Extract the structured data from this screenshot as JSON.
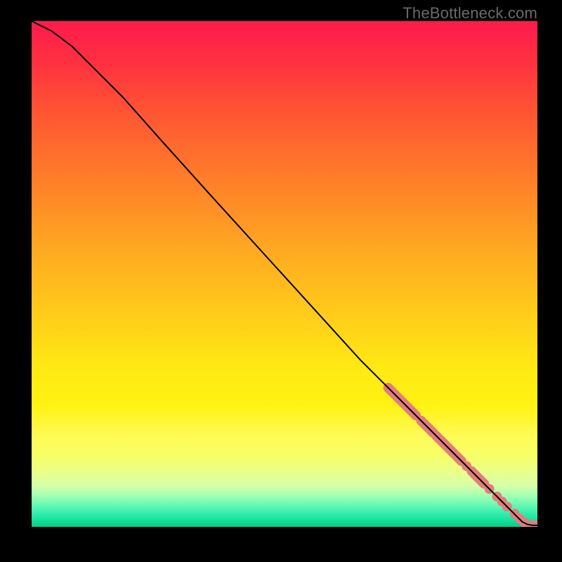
{
  "watermark": "TheBottleneck.com",
  "chart_data": {
    "type": "line",
    "title": "",
    "xlabel": "",
    "ylabel": "",
    "xlim": [
      0,
      100
    ],
    "ylim": [
      0,
      100
    ],
    "grid": false,
    "legend": false,
    "series": [
      {
        "name": "curve",
        "x": [
          0,
          4,
          8,
          12,
          18,
          26,
          35,
          45,
          55,
          65,
          72,
          78,
          83,
          87,
          90,
          93,
          95,
          97,
          98,
          99,
          100
        ],
        "y": [
          100,
          98,
          95,
          91,
          85,
          76,
          66,
          55,
          44,
          33,
          26,
          20,
          15,
          11,
          8,
          5,
          3,
          1,
          0.5,
          0.3,
          0.3
        ]
      }
    ],
    "highlight_clusters": [
      {
        "type": "segment",
        "x0": 70.5,
        "y0": 27.5,
        "x1": 76.0,
        "y1": 22.0
      },
      {
        "type": "segment",
        "x0": 77.0,
        "y0": 21.0,
        "x1": 79.5,
        "y1": 18.5
      },
      {
        "type": "segment",
        "x0": 80.0,
        "y0": 18.0,
        "x1": 85.0,
        "y1": 13.0
      },
      {
        "type": "dot",
        "x": 86.0,
        "y": 12.0
      },
      {
        "type": "dot",
        "x": 87.0,
        "y": 11.0
      },
      {
        "type": "segment",
        "x0": 87.5,
        "y0": 10.5,
        "x1": 89.5,
        "y1": 8.5
      },
      {
        "type": "dot",
        "x": 90.5,
        "y": 7.5
      },
      {
        "type": "dot",
        "x": 92.0,
        "y": 6.0
      },
      {
        "type": "dot",
        "x": 93.0,
        "y": 5.0
      },
      {
        "type": "dot",
        "x": 94.0,
        "y": 4.0
      },
      {
        "type": "dot",
        "x": 95.5,
        "y": 2.6
      },
      {
        "type": "dot",
        "x": 96.5,
        "y": 1.6
      },
      {
        "type": "dot",
        "x": 97.5,
        "y": 0.8
      },
      {
        "type": "dot",
        "x": 99.0,
        "y": 0.3
      },
      {
        "type": "dot",
        "x": 100.0,
        "y": 0.3
      }
    ],
    "colors": {
      "curve": "#000000",
      "highlight": "#e37d7d",
      "gradient_top": "#ff1a4d",
      "gradient_bottom": "#00d084"
    }
  }
}
